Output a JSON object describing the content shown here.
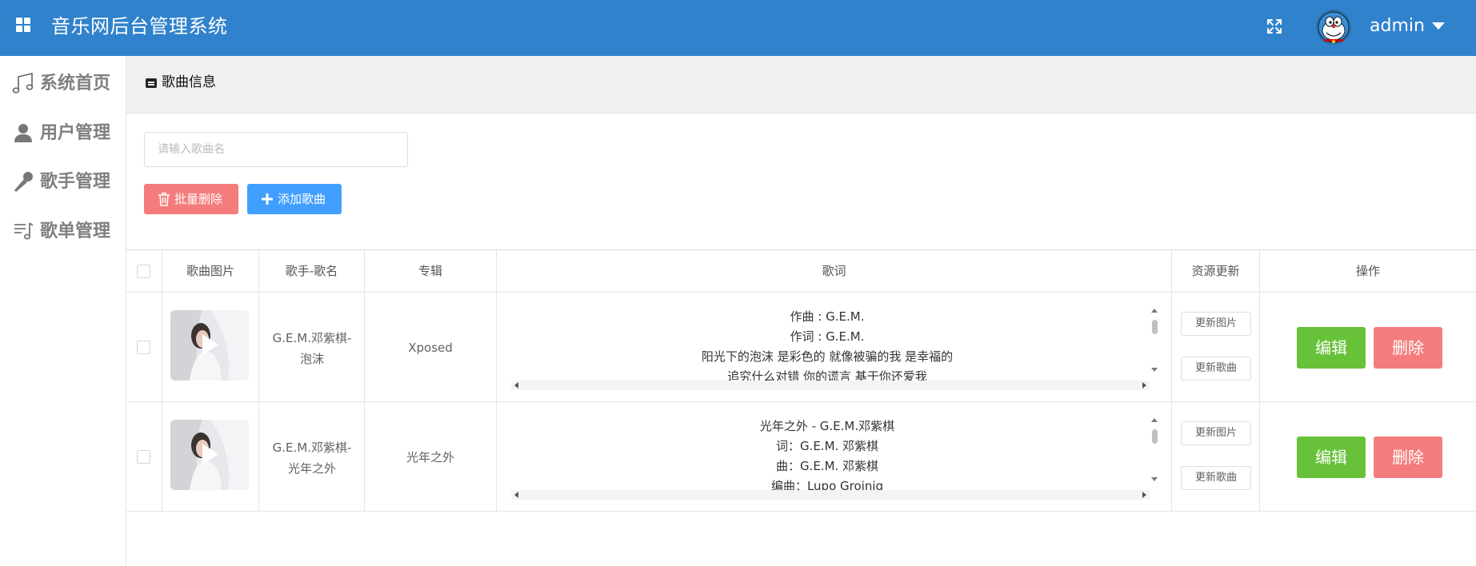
{
  "header": {
    "title": "音乐网后台管理系统",
    "user_name": "admin",
    "background": "#3182cc"
  },
  "sidebar": {
    "items": [
      {
        "label": "系统首页",
        "icon": "music-note-icon"
      },
      {
        "label": "用户管理",
        "icon": "user-icon"
      },
      {
        "label": "歌手管理",
        "icon": "microphone-icon"
      },
      {
        "label": "歌单管理",
        "icon": "playlist-icon"
      }
    ]
  },
  "breadcrumb": {
    "label": "歌曲信息"
  },
  "toolbar": {
    "search_placeholder": "请输入歌曲名",
    "batch_delete_label": "批量删除",
    "add_label": "添加歌曲"
  },
  "table": {
    "headers": [
      "歌曲图片",
      "歌手-歌名",
      "专辑",
      "歌词",
      "资源更新",
      "操作"
    ],
    "rows": [
      {
        "name_line1": "G.E.M.邓紫棋-",
        "name_line2": "泡沫",
        "album": "Xposed",
        "lyrics": [
          "作曲 : G.E.M.",
          "作词 : G.E.M.",
          "阳光下的泡沫 是彩色的 就像被骗的我 是幸福的",
          "追究什么对错 你的谎言 基于你还爱我"
        ],
        "update_image": "更新图片",
        "update_song": "更新歌曲",
        "edit": "编辑",
        "delete": "删除"
      },
      {
        "name_line1": "G.E.M.邓紫棋-",
        "name_line2": "光年之外",
        "album": "光年之外",
        "lyrics": [
          "光年之外 - G.E.M.邓紫棋",
          "词：G.E.M. 邓紫棋",
          "曲：G.E.M. 邓紫棋",
          "编曲：Lupo Groinig"
        ],
        "update_image": "更新图片",
        "update_song": "更新歌曲",
        "edit": "编辑",
        "delete": "删除"
      }
    ]
  },
  "colors": {
    "success": "#67c23a",
    "danger": "#f47c7c",
    "primary": "#409eff"
  }
}
